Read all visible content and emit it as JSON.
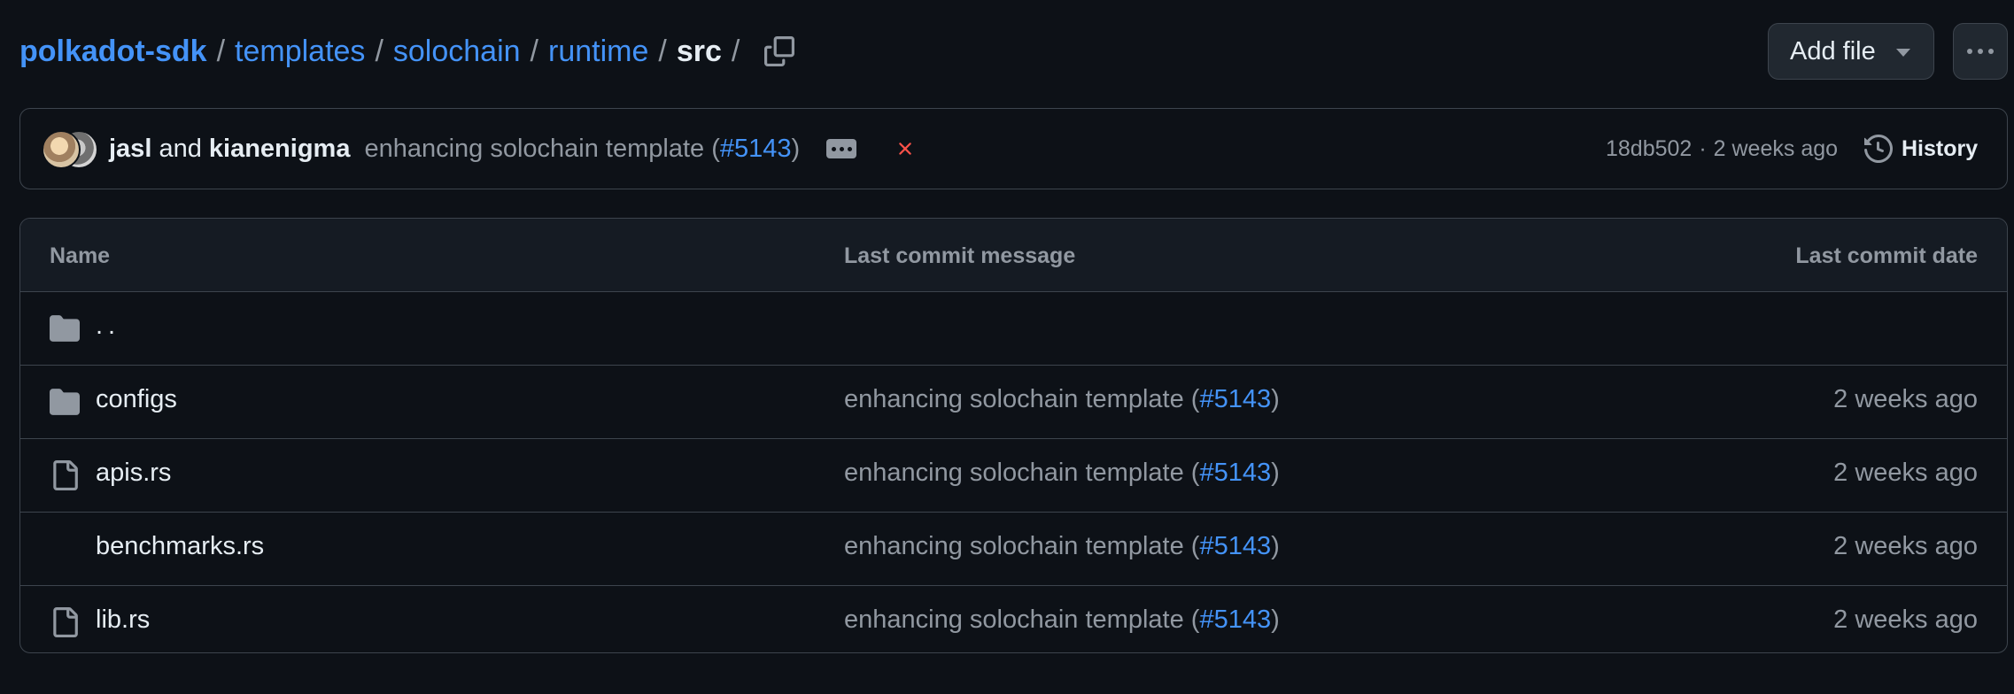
{
  "breadcrumb": {
    "root": "polkadot-sdk",
    "parts": [
      "templates",
      "solochain",
      "runtime"
    ],
    "current": "src",
    "separator": "/"
  },
  "actions": {
    "add_file_label": "Add file"
  },
  "commit": {
    "author1": "jasl",
    "joiner": "and",
    "author2": "kianenigma",
    "message_text": "enhancing solochain template (",
    "pr": "#5143",
    "message_close": ")",
    "sha": "18db502",
    "dot": "·",
    "time": "2 weeks ago",
    "history_label": "History",
    "status_color": "#f85149"
  },
  "table": {
    "headers": {
      "name": "Name",
      "message": "Last commit message",
      "date": "Last commit date"
    },
    "parent_row": "..",
    "rows": [
      {
        "name": "configs",
        "type": "folder",
        "msg": "enhancing solochain template (",
        "pr": "#5143",
        "close": ")",
        "date": "2 weeks ago"
      },
      {
        "name": "apis.rs",
        "type": "file",
        "msg": "enhancing solochain template (",
        "pr": "#5143",
        "close": ")",
        "date": "2 weeks ago"
      },
      {
        "name": "benchmarks.rs",
        "type": "file",
        "msg": "enhancing solochain template (",
        "pr": "#5143",
        "close": ")",
        "date": "2 weeks ago"
      },
      {
        "name": "lib.rs",
        "type": "file",
        "msg": "enhancing solochain template (",
        "pr": "#5143",
        "close": ")",
        "date": "2 weeks ago"
      }
    ]
  },
  "colors": {
    "background": "#0d1117",
    "link": "#4493f8",
    "muted": "#9198a1",
    "border": "#3d444d"
  }
}
